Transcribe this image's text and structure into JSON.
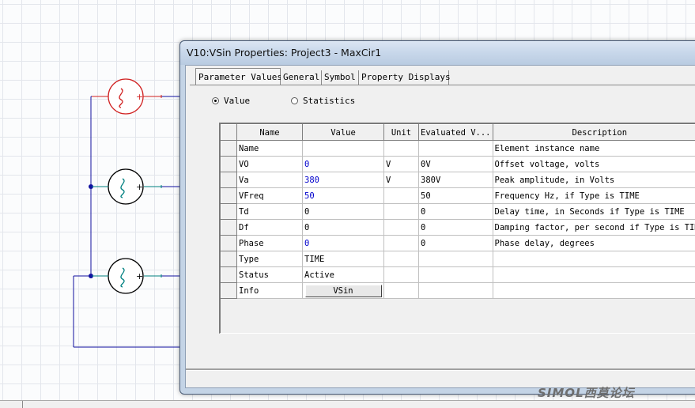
{
  "dialog": {
    "title": "V10:VSin Properties: Project3 - MaxCir1",
    "tabs": [
      {
        "label": "Parameter Values",
        "active": true
      },
      {
        "label": "General",
        "active": false
      },
      {
        "label": "Symbol",
        "active": false
      },
      {
        "label": "Property Displays",
        "active": false
      }
    ],
    "radios": [
      {
        "label": "Value",
        "selected": true
      },
      {
        "label": "Statistics",
        "selected": false
      }
    ],
    "columns": [
      "Name",
      "Value",
      "Unit",
      "Evaluated V...",
      "Description"
    ],
    "rows": [
      {
        "name": "Name",
        "value": "",
        "unit": "",
        "evaluated": "",
        "description": "Element instance name"
      },
      {
        "name": "VO",
        "value": "0",
        "unit": "V",
        "evaluated": "0V",
        "description": "Offset voltage, volts"
      },
      {
        "name": "Va",
        "value": "380",
        "unit": "V",
        "evaluated": "380V",
        "description": "Peak amplitude, in Volts"
      },
      {
        "name": "VFreq",
        "value": "50",
        "unit": "",
        "evaluated": "50",
        "description": "Frequency Hz, if Type is TIME"
      },
      {
        "name": "Td",
        "value": "0",
        "unit": "",
        "evaluated": "0",
        "description": "Delay time, in Seconds if Type is TIME"
      },
      {
        "name": "Df",
        "value": "0",
        "unit": "",
        "evaluated": "0",
        "description": "Damping factor, per second if Type is TIME"
      },
      {
        "name": "Phase",
        "value": "0",
        "unit": "",
        "evaluated": "0",
        "description": "Phase delay, degrees"
      },
      {
        "name": "Type",
        "value": "TIME",
        "unit": "",
        "evaluated": "",
        "description": ""
      },
      {
        "name": "Status",
        "value": "Active",
        "unit": "",
        "evaluated": "",
        "description": ""
      }
    ],
    "info_row": {
      "name": "Info",
      "button_label": "VSin"
    }
  },
  "watermark": "SIMOL西莫论坛",
  "colors": {
    "wire_blue": "#1010a0",
    "source_red": "#d02020",
    "terminal_teal": "#008080",
    "value_blue": "#0000cc"
  }
}
